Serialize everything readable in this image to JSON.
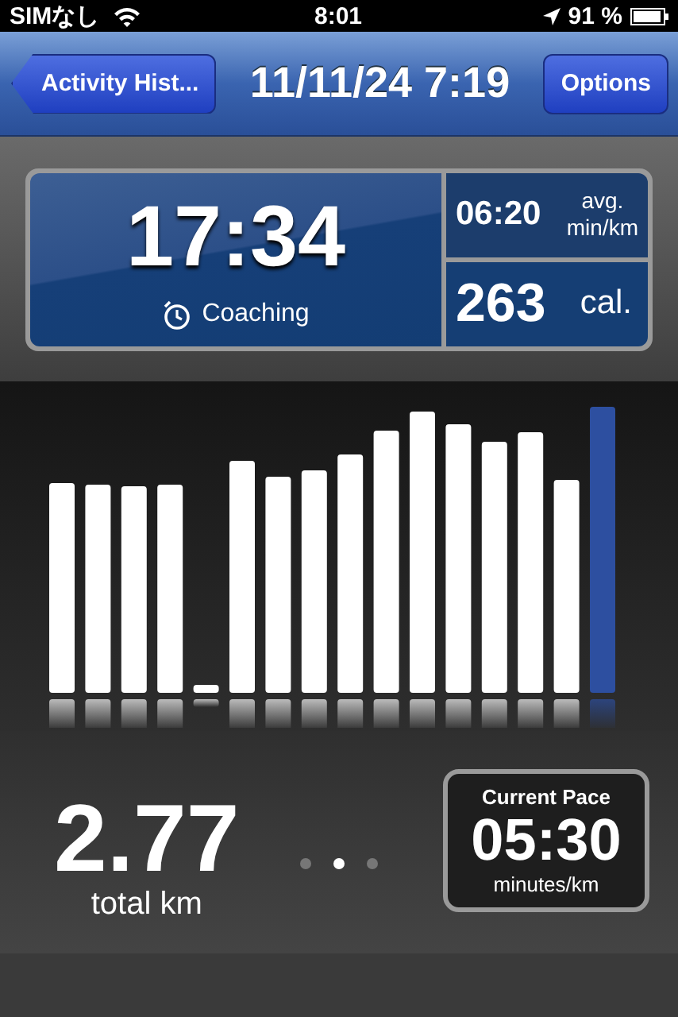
{
  "status_bar": {
    "carrier": "SIMなし",
    "time": "8:01",
    "battery": "91 %"
  },
  "nav_bar": {
    "back": "Activity Hist...",
    "title": "11/11/24 7:19",
    "action": "Options"
  },
  "summary": {
    "duration": "17:34",
    "mode": "Coaching",
    "pace": "06:20",
    "pace_unit_top": "avg.",
    "pace_unit_bottom": "min/km",
    "calories": "263",
    "calories_unit": "cal."
  },
  "distance": {
    "value": "2.77",
    "unit": "total km"
  },
  "current_pace": {
    "label": "Current Pace",
    "value": "05:30",
    "unit": "minutes/km"
  },
  "pages": [
    {
      "selected": false
    },
    {
      "selected": true
    },
    {
      "selected": false
    }
  ]
}
